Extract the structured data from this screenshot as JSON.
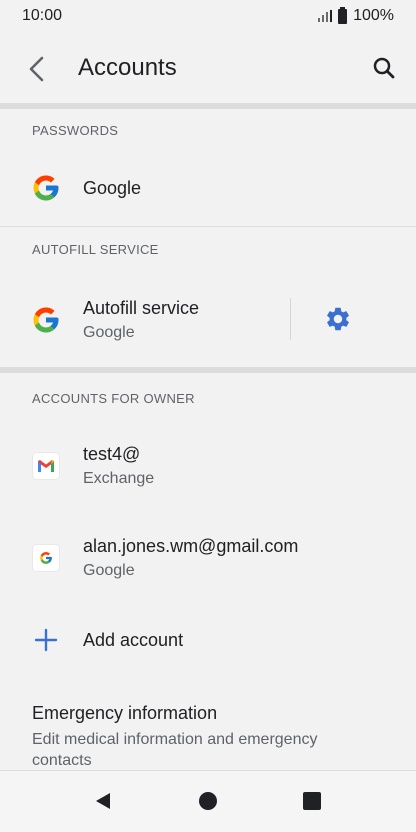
{
  "status_bar": {
    "time": "10:00",
    "battery": "100%"
  },
  "header": {
    "title": "Accounts",
    "back_icon": "back-arrow-icon",
    "search_icon": "search-icon"
  },
  "passwords": {
    "header": "PASSWORDS",
    "item": {
      "title": "Google",
      "icon": "google-icon"
    }
  },
  "autofill": {
    "header": "AUTOFILL SERVICE",
    "item": {
      "title": "Autofill service",
      "subtitle": "Google",
      "icon": "google-icon",
      "settings_icon": "gear-icon"
    }
  },
  "accounts": {
    "header": "ACCOUNTS FOR OWNER",
    "items": [
      {
        "title": "test4@",
        "subtitle": "Exchange",
        "icon": "gmail-icon"
      },
      {
        "title": "alan.jones.wm@gmail.com",
        "subtitle": "Google",
        "icon": "google-icon"
      }
    ],
    "add_label": "Add account"
  },
  "emergency": {
    "title": "Emergency information",
    "description": "Edit medical information and emergency contacts"
  },
  "colors": {
    "accent": "#3c6fd1",
    "background": "#f2f2f2",
    "divider": "#dcdcdc"
  },
  "nav": {
    "back_icon": "nav-back-icon",
    "home_icon": "nav-home-icon",
    "recents_icon": "nav-recents-icon"
  }
}
